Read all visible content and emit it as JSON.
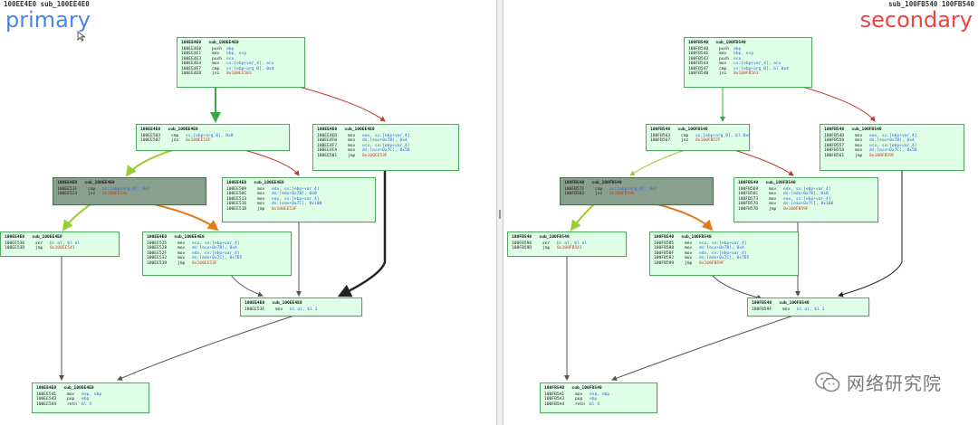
{
  "left": {
    "header": "100EE4E0 sub_100EE4E0",
    "label": "primary",
    "blocks": [
      {
        "id": "b0",
        "head": "100EE4E0   sub_100EE4E0",
        "rows": [
          [
            "100EE4E0",
            "push",
            "ebp",
            ""
          ],
          [
            "100EE4E1",
            "mov",
            "ebp, esp",
            ""
          ],
          [
            "100EE4E3",
            "push",
            "ecx",
            ""
          ],
          [
            "100EE4E4",
            "mov",
            "ss:[ebp+var_4], ecx",
            ""
          ],
          [
            "100EE4E7",
            "cmp",
            "ss:[ebp+arg_0], 0x4",
            ""
          ],
          [
            "100EE4EB",
            "jnz",
            "0x100EE503",
            "r"
          ]
        ]
      },
      {
        "id": "b1",
        "head": "100EE4E0   sub_100EE4E0",
        "rows": [
          [
            "100EE503",
            "cmp",
            "ss:[ebp+arg_0], 0x8",
            ""
          ],
          [
            "100EE507",
            "jnz",
            "0x100EE51F",
            "r"
          ]
        ]
      },
      {
        "id": "b2",
        "head": "100EE4E0   sub_100EE4E0",
        "rows": [
          [
            "100EE4ED",
            "mov",
            "eax, ss:[ebp+var_4]",
            ""
          ],
          [
            "100EE4F0",
            "mov",
            "ds:[eax+0x78], 0x4",
            ""
          ],
          [
            "100EE4F7",
            "mov",
            "ecx, ss:[ebp+var_4]",
            ""
          ],
          [
            "100EE4FA",
            "mov",
            "ds:[ecx+0x7C], 0x50",
            ""
          ],
          [
            "100EE501",
            "jmp",
            "0x100EE53F",
            "r"
          ]
        ]
      },
      {
        "id": "b3",
        "head": "100EE4E0   sub_100EE4E0",
        "rows": [
          [
            "100EE51F",
            "cmp",
            "ss:[ebp+arg_0], 0xC",
            ""
          ],
          [
            "100EE523",
            "jnz",
            "0x100EE536",
            "r"
          ]
        ]
      },
      {
        "id": "b4",
        "head": "100EE4E0   sub_100EE4E0",
        "rows": [
          [
            "100EE509",
            "mov",
            "edx, ss:[ebp+var_4]",
            ""
          ],
          [
            "100EE50C",
            "mov",
            "ds:[edx+0x78], 0x8",
            ""
          ],
          [
            "100EE513",
            "mov",
            "eax, ss:[ebp+var_4]",
            ""
          ],
          [
            "100EE516",
            "mov",
            "ds:[eax+0x7C], 0x100",
            ""
          ],
          [
            "100EE51D",
            "jmp",
            "0x100EE53F",
            "r"
          ]
        ]
      },
      {
        "id": "b5",
        "head": "100EE4E0   sub_100EE4E0",
        "rows": [
          [
            "100EE536",
            "xor",
            "bl al, bl al",
            ""
          ],
          [
            "100EE53D",
            "jmp",
            "0x100EE541",
            "r"
          ]
        ]
      },
      {
        "id": "b6",
        "head": "100EE4E0   sub_100EE4E0",
        "rows": [
          [
            "100EE525",
            "mov",
            "ecx, ss:[ebp+var_4]",
            ""
          ],
          [
            "100EE528",
            "mov",
            "ds:[ecx+0x78], 0xA",
            ""
          ],
          [
            "100EE52F",
            "mov",
            "edx, ss:[ebp+var_4]",
            ""
          ],
          [
            "100EE532",
            "mov",
            "ds:[edx+0x7C], 0x7D5",
            ""
          ],
          [
            "100EE539",
            "jmp",
            "0x100EE53F",
            "r"
          ]
        ]
      },
      {
        "id": "b7",
        "head": "100EE4E0   sub_100EE4E0",
        "rows": [
          [
            "100EE53F",
            "mov",
            "bl al, bl 1",
            ""
          ]
        ]
      },
      {
        "id": "b8",
        "head": "100EE4E0   sub_100EE4E0",
        "rows": [
          [
            "100EE541",
            "mov",
            "esp, ebp",
            ""
          ],
          [
            "100EE543",
            "pop",
            "ebp",
            ""
          ],
          [
            "100EE544",
            "retn",
            "bl 4",
            ""
          ]
        ]
      }
    ]
  },
  "right": {
    "header": "sub_100FB540 100FB540",
    "label": "secondary",
    "blocks": [
      {
        "id": "b0",
        "head": "100FB540   sub_100FB540",
        "rows": [
          [
            "100FB540",
            "push",
            "ebp",
            ""
          ],
          [
            "100FB541",
            "mov",
            "ebp, esp",
            ""
          ],
          [
            "100FB543",
            "push",
            "ecx",
            ""
          ],
          [
            "100FB544",
            "mov",
            "ss:[ebp+var_4], ecx",
            ""
          ],
          [
            "100FB547",
            "cmp",
            "ss:[ebp+arg_0], bl 0x4",
            ""
          ],
          [
            "100FB54B",
            "jnz",
            "0x100FB563",
            "r"
          ]
        ]
      },
      {
        "id": "b1",
        "head": "100FB540   sub_100FB540",
        "rows": [
          [
            "100FB563",
            "cmp",
            "ss:[ebp+arg_0], bl 0x8",
            ""
          ],
          [
            "100FB567",
            "jnz",
            "0x100FB57F",
            "r"
          ]
        ]
      },
      {
        "id": "b2",
        "head": "100FB540   sub_100FB540",
        "rows": [
          [
            "100FB54D",
            "mov",
            "eax, ss:[ebp+var_4]",
            ""
          ],
          [
            "100FB550",
            "mov",
            "ds:[eax+0x78], 0x4",
            ""
          ],
          [
            "100FB557",
            "mov",
            "ecx, ss:[ebp+var_4]",
            ""
          ],
          [
            "100FB55A",
            "mov",
            "ds:[ecx+0x7C], 0x50",
            ""
          ],
          [
            "100FB561",
            "jmp",
            "0x100FB59F",
            "r"
          ]
        ]
      },
      {
        "id": "b3",
        "head": "100FB540   sub_100FB540",
        "rows": [
          [
            "100FB57F",
            "cmp",
            "ss:[ebp+arg_0], 0xC",
            ""
          ],
          [
            "100FB583",
            "jnz",
            "0x100FB596",
            "r"
          ]
        ]
      },
      {
        "id": "b4",
        "head": "100FB540   sub_100FB540",
        "rows": [
          [
            "100FB569",
            "mov",
            "edx, ss:[ebp+var_4]",
            ""
          ],
          [
            "100FB56C",
            "mov",
            "ds:[edx+0x78], 0x8",
            ""
          ],
          [
            "100FB573",
            "mov",
            "eax, ss:[ebp+var_4]",
            ""
          ],
          [
            "100FB576",
            "mov",
            "ds:[eax+0x7C], 0x100",
            ""
          ],
          [
            "100FB57D",
            "jmp",
            "0x100FB59F",
            "r"
          ]
        ]
      },
      {
        "id": "b5",
        "head": "100FB540   sub_100FB540",
        "rows": [
          [
            "100FB596",
            "xor",
            "bl al, bl al",
            ""
          ],
          [
            "100FB59D",
            "jmp",
            "0x100FB5A1",
            "r"
          ]
        ]
      },
      {
        "id": "b6",
        "head": "100FB540   sub_100FB540",
        "rows": [
          [
            "100FB585",
            "mov",
            "ecx, ss:[ebp+var_4]",
            ""
          ],
          [
            "100FB588",
            "mov",
            "ds:[ecx+0x78], 0xA",
            ""
          ],
          [
            "100FB58F",
            "mov",
            "edx, ss:[ebp+var_4]",
            ""
          ],
          [
            "100FB592",
            "mov",
            "ds:[edx+0x7C], 0x7D5",
            ""
          ],
          [
            "100FB599",
            "jmp",
            "0x100FB59F",
            "r"
          ]
        ]
      },
      {
        "id": "b7",
        "head": "100FB540   sub_100FB540",
        "rows": [
          [
            "100FB59F",
            "mov",
            "bl al, bl 1",
            ""
          ]
        ]
      },
      {
        "id": "b8",
        "head": "100FB540   sub_100FB540",
        "rows": [
          [
            "100FB5A1",
            "mov",
            "esp, ebp",
            ""
          ],
          [
            "100FB5A3",
            "pop",
            "ebp",
            ""
          ],
          [
            "100FB5A4",
            "retn",
            "bl 4",
            ""
          ]
        ]
      }
    ]
  },
  "watermark": {
    "text": "网络研究院",
    "icon": "wechat-logo-icon"
  },
  "colors": {
    "block_fill": "#dfffe7",
    "block_border": "#4faa64",
    "selected_fill": "#8aa08f",
    "edge_green": "#3aa84a",
    "edge_red": "#c0392b",
    "edge_yellowgreen": "#9acd32",
    "edge_orange": "#e07b1a",
    "edge_dark": "#222222",
    "edge_gray": "#555555",
    "operand_blue": "#2a5fd0",
    "operand_red": "#c0392b",
    "primary_label": "#4a86e8",
    "secondary_label": "#e8473f"
  }
}
